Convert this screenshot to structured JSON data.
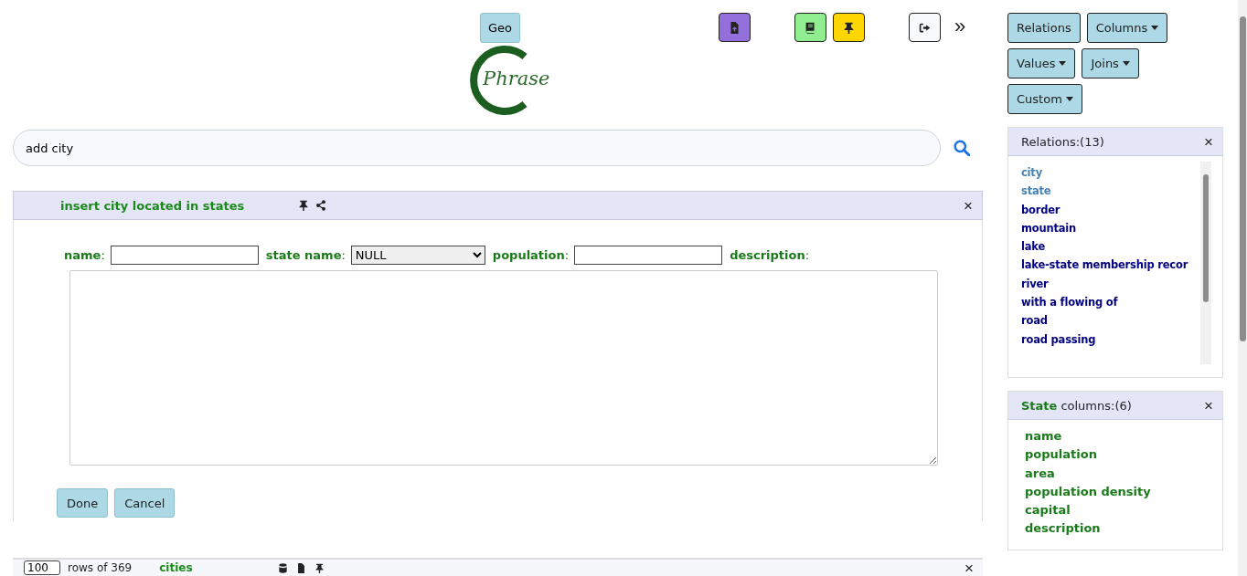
{
  "top_bar": {
    "db_button": "Geo",
    "icon_buttons": [
      {
        "kind": "upload",
        "color": "#9370db"
      },
      {
        "kind": "book",
        "color": "#90ee90"
      },
      {
        "kind": "pin",
        "color": "#ffd700"
      },
      {
        "kind": "logout",
        "color": "#f8f9fa"
      }
    ],
    "expand": "»"
  },
  "logo": {
    "text": "Phrase"
  },
  "search": {
    "value": "add city"
  },
  "query_panel": {
    "title": "insert city located in states",
    "close": "×",
    "fields": [
      {
        "kind": "input",
        "label": "**name**:"
      },
      {
        "kind": "select",
        "label": "**state name**:",
        "value": "NULL"
      },
      {
        "kind": "input",
        "label": "**population**:"
      },
      {
        "kind": "textarea",
        "label": "**description**:"
      }
    ],
    "buttons": [
      "Done",
      "Cancel"
    ]
  },
  "result_bar": {
    "limit": "100",
    "rows_text": "rows of 369",
    "relation": "cities",
    "close": "×"
  },
  "toolbar": [
    {
      "label": "Relations",
      "dropdown": false
    },
    {
      "label": "Columns",
      "dropdown": true
    },
    {
      "label": "Values",
      "dropdown": true
    },
    {
      "label": "Joins",
      "dropdown": true
    },
    {
      "label": "Custom",
      "dropdown": true
    }
  ],
  "relations_panel": {
    "title": "Relations:(13)",
    "close": "×",
    "items": [
      {
        "label": "city",
        "selected": true
      },
      {
        "label": "state",
        "selected": true
      },
      {
        "label": "border",
        "selected": false
      },
      {
        "label": "mountain",
        "selected": false
      },
      {
        "label": "lake",
        "selected": false
      },
      {
        "label": "lake-state membership recor",
        "selected": false
      },
      {
        "label": "river",
        "selected": false
      },
      {
        "label": "with a flowing of",
        "selected": false
      },
      {
        "label": "road",
        "selected": false
      },
      {
        "label": "road passing",
        "selected": false
      }
    ]
  },
  "columns_panel": {
    "relation": "State",
    "title": "columns:(6)",
    "close": "×",
    "items": [
      "name",
      "population",
      "area",
      "population density",
      "capital",
      "description"
    ]
  }
}
